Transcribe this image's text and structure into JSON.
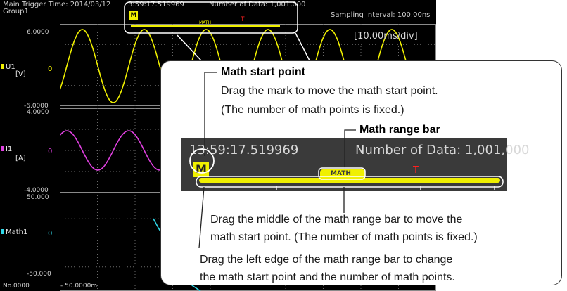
{
  "header": {
    "trigger_time": "Main Trigger Time: 2014/03/12  13:59:17.519969",
    "trigger_time_left": "Main Trigger Time: 2014/03/12",
    "trigger_time_right": "3:59:17.519969",
    "group": "Group1",
    "data_count": "Number of Data: 1,001,000",
    "sampling": "Sampling Interval: 100.00ns",
    "time_div": "[10.00ms/div]"
  },
  "channels": [
    {
      "name": "U1",
      "unit": "[V]",
      "top": "6.0000",
      "bottom": "-6.0000",
      "zero": "0",
      "color": "#f0f000"
    },
    {
      "name": "I1",
      "unit": "[A]",
      "top": "4.0000",
      "bottom": "-4.0000",
      "zero": "0",
      "color": "#e040e0"
    },
    {
      "name": "Math1",
      "unit": "",
      "top": "50.000",
      "bottom": "-50.000",
      "zero": "0",
      "color": "#30d8e8"
    }
  ],
  "footer": {
    "record_no": "No.0000",
    "x_start": "- 50.0000m"
  },
  "math_bar": {
    "label": "MATH",
    "start_mark": "M",
    "trigger_mark": "T"
  },
  "callout": {
    "start_title": "Math start point",
    "start_desc_1": "Drag the mark to move the math start point.",
    "start_desc_2": "(The number of math points is fixed.)",
    "range_title": "Math range bar",
    "zoom_time": "13:59:17.519969",
    "zoom_count": "Number of Data: 1,001,000",
    "middle_desc_1": "Drag the middle of the math range bar to move the",
    "middle_desc_2": "math start point. (The number of math points is fixed.)",
    "left_desc_1": "Drag the left edge of the math range bar to change",
    "left_desc_2": "the math start point and the number of math points."
  },
  "colors": {
    "u1": "#f0f000",
    "i1": "#e040e0",
    "math1": "#30d8e8",
    "math_bar": "#f0f000",
    "trigger_mark": "#ff2020",
    "screen_bg": "#000000",
    "grid": "#707070"
  }
}
